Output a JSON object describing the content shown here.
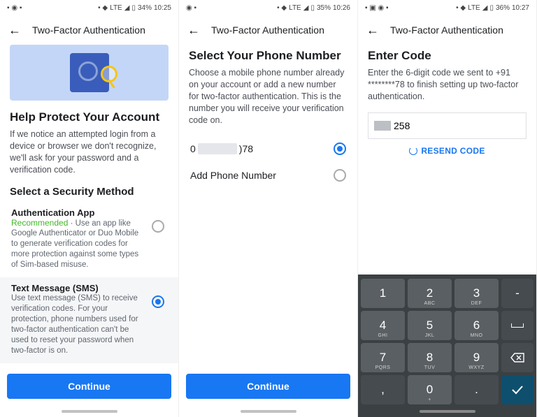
{
  "statusbar": {
    "s1": {
      "lte": "LTE",
      "battery": "34%",
      "time": "10:25"
    },
    "s2": {
      "lte": "LTE",
      "battery": "35%",
      "time": "10:26"
    },
    "s3": {
      "lte": "LTE",
      "battery": "36%",
      "time": "10:27"
    }
  },
  "appbar_title": "Two-Factor Authentication",
  "screen1": {
    "heading": "Help Protect Your Account",
    "desc": "If we notice an attempted login from a device or browser we don't recognize, we'll ask for your password and a verification code.",
    "select_heading": "Select a Security Method",
    "methods": [
      {
        "title": "Authentication App",
        "recommended": "Recommended",
        "sep": " · ",
        "desc": "Use an app like Google Authenticator or Duo Mobile to generate verification codes for more protection against some types of Sim-based misuse.",
        "selected": false
      },
      {
        "title": "Text Message (SMS)",
        "desc": "Use text message (SMS) to receive verification codes. For your protection, phone numbers used for two-factor authentication can't be used to reset your password when two-factor is on.",
        "selected": true
      }
    ],
    "continue": "Continue"
  },
  "screen2": {
    "heading": "Select Your Phone Number",
    "desc": "Choose a mobile phone number already on your account or add a new number for two-factor authentication. This is the number you will receive your verification code on.",
    "phone_prefix": "0",
    "phone_suffix": ")78",
    "add_phone": "Add Phone Number",
    "continue": "Continue"
  },
  "screen3": {
    "heading": "Enter Code",
    "desc": "Enter the 6-digit code we sent to +91 ********78 to finish setting up two-factor authentication.",
    "code_value": "258",
    "resend": "RESEND CODE"
  },
  "keypad": {
    "rows": [
      [
        {
          "k": "1"
        },
        {
          "k": "2",
          "s": "ABC"
        },
        {
          "k": "3",
          "s": "DEF"
        },
        {
          "k": "-",
          "dark": true
        }
      ],
      [
        {
          "k": "4",
          "s": "GHI"
        },
        {
          "k": "5",
          "s": "JKL"
        },
        {
          "k": "6",
          "s": "MNO"
        },
        {
          "k": "␣",
          "dark": true,
          "space": true
        }
      ],
      [
        {
          "k": "7",
          "s": "PQRS"
        },
        {
          "k": "8",
          "s": "TUV"
        },
        {
          "k": "9",
          "s": "WXYZ"
        },
        {
          "k": "⌫",
          "dark": true,
          "del": true
        }
      ],
      [
        {
          "k": ",",
          "dark": true
        },
        {
          "k": "0",
          "s": "+"
        },
        {
          "k": ".",
          "dark": true
        },
        {
          "k": "✓",
          "check": true
        }
      ]
    ]
  }
}
